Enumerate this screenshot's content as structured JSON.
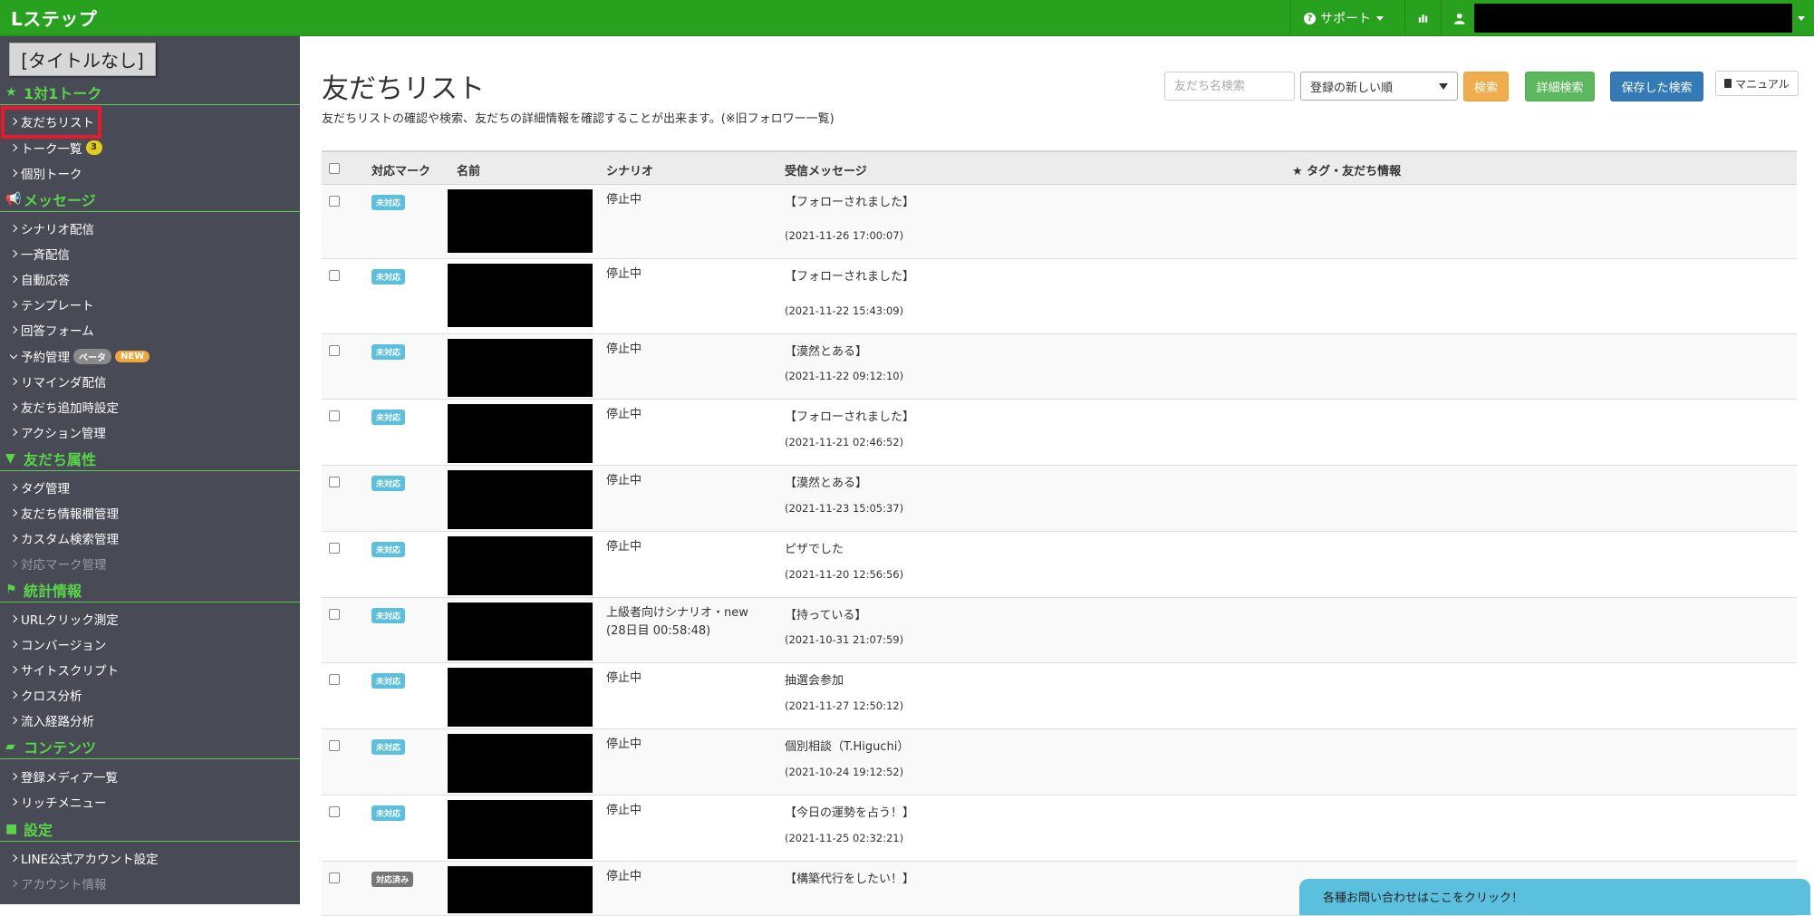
{
  "app": {
    "logo": "Lステップ"
  },
  "topnav": {
    "support": "サポート"
  },
  "sidebar": {
    "no_title": "[タイトルなし]",
    "sections": {
      "talk": "1対1トーク",
      "message": "メッセージ",
      "attr": "友だち属性",
      "stats": "統計情報",
      "contents": "コンテンツ",
      "settings": "設定"
    },
    "items": {
      "friend_list": "友だちリスト",
      "talk_list": "トーク一覧",
      "talk_list_badge": "3",
      "individual_talk": "個別トーク",
      "scenario": "シナリオ配信",
      "broadcast": "一斉配信",
      "auto_reply": "自動応答",
      "template": "テンプレート",
      "form": "回答フォーム",
      "reservation": "予約管理",
      "beta": "ベータ",
      "new": "NEW",
      "reminder": "リマインダ配信",
      "friend_add": "友だち追加時設定",
      "action": "アクション管理",
      "tag": "タグ管理",
      "friend_info": "友だち情報欄管理",
      "custom_search": "カスタム検索管理",
      "mark_mgmt": "対応マーク管理",
      "url_click": "URLクリック測定",
      "conversion": "コンバージョン",
      "site_script": "サイトスクリプト",
      "cross": "クロス分析",
      "inflow": "流入経路分析",
      "media": "登録メディア一覧",
      "rich_menu": "リッチメニュー",
      "line_account": "LINE公式アカウント設定",
      "account_info": "アカウント情報"
    }
  },
  "main": {
    "title": "友だちリスト",
    "description": "友だちリストの確認や検索、友だちの詳細情報を確認することが出来ます。(※旧フォロワー一覧)",
    "search_placeholder": "友だち名検索",
    "sort_selected": "登録の新しい順",
    "btn_search": "検索",
    "btn_detail": "詳細検索",
    "btn_saved": "保存した検索",
    "btn_manual": "マニュアル"
  },
  "table": {
    "headers": {
      "mark": "対応マーク",
      "name": "名前",
      "scenario": "シナリオ",
      "message": "受信メッセージ",
      "tags": "★ タグ・友だち情報"
    },
    "rows": [
      {
        "mark": "未対応",
        "scenario": "停止中",
        "scenario2": "",
        "message": "【フォローされました】",
        "date": "(2021-11-26 17:00:07)"
      },
      {
        "mark": "未対応",
        "scenario": "停止中",
        "scenario2": "",
        "message": "【フォローされました】",
        "date": "(2021-11-22 15:43:09)"
      },
      {
        "mark": "未対応",
        "scenario": "停止中",
        "scenario2": "",
        "message": "【漠然とある】",
        "date": "(2021-11-22 09:12:10)"
      },
      {
        "mark": "未対応",
        "scenario": "停止中",
        "scenario2": "",
        "message": "【フォローされました】",
        "date": "(2021-11-21 02:46:52)"
      },
      {
        "mark": "未対応",
        "scenario": "停止中",
        "scenario2": "",
        "message": "【漠然とある】",
        "date": "(2021-11-23 15:05:37)"
      },
      {
        "mark": "未対応",
        "scenario": "停止中",
        "scenario2": "",
        "message": "ピザでした",
        "date": "(2021-11-20 12:56:56)"
      },
      {
        "mark": "未対応",
        "scenario": "上級者向けシナリオ・new",
        "scenario2": "(28日目 00:58:48)",
        "message": "【持っている】",
        "date": "(2021-10-31 21:07:59)"
      },
      {
        "mark": "未対応",
        "scenario": "停止中",
        "scenario2": "",
        "message": "抽選会参加",
        "date": "(2021-11-27 12:50:12)"
      },
      {
        "mark": "未対応",
        "scenario": "停止中",
        "scenario2": "",
        "message": "個別相談（T.Higuchi）",
        "date": "(2021-10-24 19:12:52)"
      },
      {
        "mark": "未対応",
        "scenario": "停止中",
        "scenario2": "",
        "message": "【今日の運勢を占う！】",
        "date": "(2021-11-25 02:32:21)"
      },
      {
        "mark": "対応済み",
        "scenario": "停止中",
        "scenario2": "",
        "message": "【構築代行をしたい！】",
        "date": ""
      }
    ]
  },
  "contact": "各種お問い合わせはここをクリック！"
}
